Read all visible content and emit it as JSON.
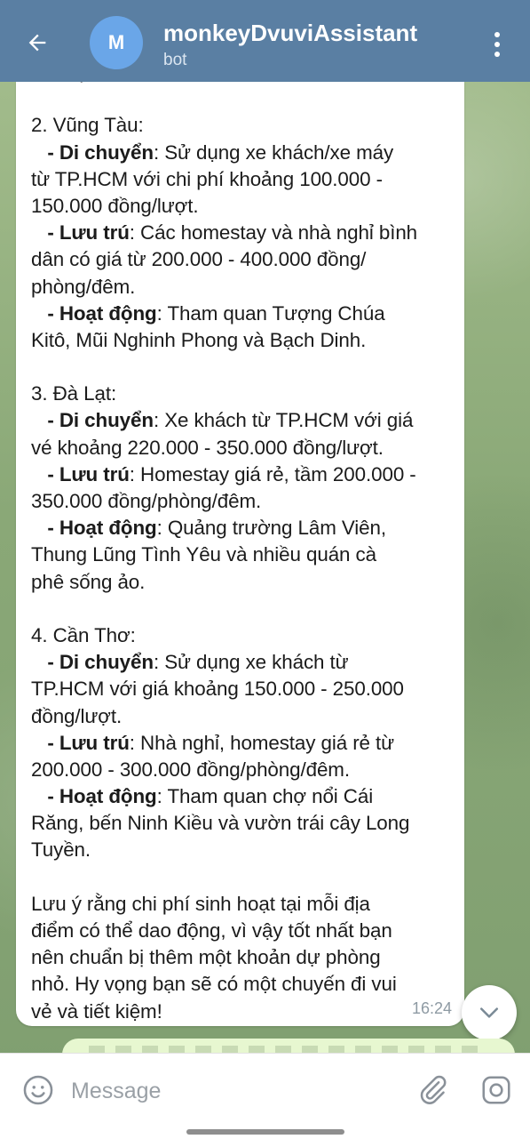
{
  "header": {
    "avatar_letter": "M",
    "title": "monkeyDvuviAssistant",
    "subtitle": "bot",
    "color": "#5a7fa3"
  },
  "message": {
    "lines": [
      {
        "parts": [
          {
            "t": "miễn phí.",
            "b": false
          }
        ]
      },
      {
        "parts": []
      },
      {
        "parts": [
          {
            "t": "2. Vũng Tàu:",
            "b": false
          }
        ]
      },
      {
        "parts": [
          {
            "t": "   - Di chuyển",
            "b": true
          },
          {
            "t": ": Sử dụng xe khách/xe máy",
            "b": false
          }
        ]
      },
      {
        "parts": [
          {
            "t": "từ TP.HCM với chi phí khoảng 100.000 -",
            "b": false
          }
        ]
      },
      {
        "parts": [
          {
            "t": "150.000 đồng/lượt.",
            "b": false
          }
        ]
      },
      {
        "parts": [
          {
            "t": "   - Lưu trú",
            "b": true
          },
          {
            "t": ": Các homestay và nhà nghỉ bình",
            "b": false
          }
        ]
      },
      {
        "parts": [
          {
            "t": "dân có giá từ 200.000 - 400.000 đồng/",
            "b": false
          }
        ]
      },
      {
        "parts": [
          {
            "t": "phòng/đêm.",
            "b": false
          }
        ]
      },
      {
        "parts": [
          {
            "t": "   - Hoạt động",
            "b": true
          },
          {
            "t": ": Tham quan Tượng Chúa",
            "b": false
          }
        ]
      },
      {
        "parts": [
          {
            "t": "Kitô, Mũi Nghinh Phong và Bạch Dinh.",
            "b": false
          }
        ]
      },
      {
        "parts": []
      },
      {
        "parts": [
          {
            "t": "3. Đà Lạt:",
            "b": false
          }
        ]
      },
      {
        "parts": [
          {
            "t": "   - Di chuyển",
            "b": true
          },
          {
            "t": ": Xe khách từ TP.HCM với giá",
            "b": false
          }
        ]
      },
      {
        "parts": [
          {
            "t": "vé khoảng 220.000 - 350.000 đồng/lượt.",
            "b": false
          }
        ]
      },
      {
        "parts": [
          {
            "t": "   - Lưu trú",
            "b": true
          },
          {
            "t": ": Homestay giá rẻ, tầm 200.000 -",
            "b": false
          }
        ]
      },
      {
        "parts": [
          {
            "t": "350.000 đồng/phòng/đêm.",
            "b": false
          }
        ]
      },
      {
        "parts": [
          {
            "t": "   - Hoạt động",
            "b": true
          },
          {
            "t": ": Quảng trường Lâm Viên,",
            "b": false
          }
        ]
      },
      {
        "parts": [
          {
            "t": "Thung Lũng Tình Yêu và nhiều quán cà",
            "b": false
          }
        ]
      },
      {
        "parts": [
          {
            "t": "phê sống ảo.",
            "b": false
          }
        ]
      },
      {
        "parts": []
      },
      {
        "parts": [
          {
            "t": "4. Cần Thơ:",
            "b": false
          }
        ]
      },
      {
        "parts": [
          {
            "t": "   - Di chuyển",
            "b": true
          },
          {
            "t": ": Sử dụng xe khách từ",
            "b": false
          }
        ]
      },
      {
        "parts": [
          {
            "t": "TP.HCM với giá khoảng 150.000 - 250.000",
            "b": false
          }
        ]
      },
      {
        "parts": [
          {
            "t": "đồng/lượt.",
            "b": false
          }
        ]
      },
      {
        "parts": [
          {
            "t": "   - Lưu trú",
            "b": true
          },
          {
            "t": ": Nhà nghỉ, homestay giá rẻ từ",
            "b": false
          }
        ]
      },
      {
        "parts": [
          {
            "t": "200.000 - 300.000 đồng/phòng/đêm.",
            "b": false
          }
        ]
      },
      {
        "parts": [
          {
            "t": "   - Hoạt động",
            "b": true
          },
          {
            "t": ": Tham quan chợ nổi Cái",
            "b": false
          }
        ]
      },
      {
        "parts": [
          {
            "t": "Răng, bến Ninh Kiều và vườn trái cây Long",
            "b": false
          }
        ]
      },
      {
        "parts": [
          {
            "t": "Tuyền.",
            "b": false
          }
        ]
      },
      {
        "parts": []
      },
      {
        "parts": [
          {
            "t": "Lưu ý rằng chi phí sinh hoạt tại mỗi địa",
            "b": false
          }
        ]
      },
      {
        "parts": [
          {
            "t": "điểm có thể dao động, vì vậy tốt nhất bạn",
            "b": false
          }
        ]
      },
      {
        "parts": [
          {
            "t": "nên chuẩn bị thêm một khoản dự phòng",
            "b": false
          }
        ]
      },
      {
        "parts": [
          {
            "t": "nhỏ. Hy vọng bạn sẽ có một chuyến đi vui",
            "b": false
          }
        ]
      },
      {
        "parts": [
          {
            "t": "vẻ và tiết kiệm!",
            "b": false
          }
        ]
      }
    ],
    "time": "16:24"
  },
  "input": {
    "placeholder": "Message"
  },
  "icons": {
    "back": "back-arrow-icon",
    "menu": "more-vertical-icon",
    "scroll": "chevron-down-icon",
    "emoji": "emoji-icon",
    "attach": "paperclip-icon",
    "camera": "camera-icon"
  }
}
